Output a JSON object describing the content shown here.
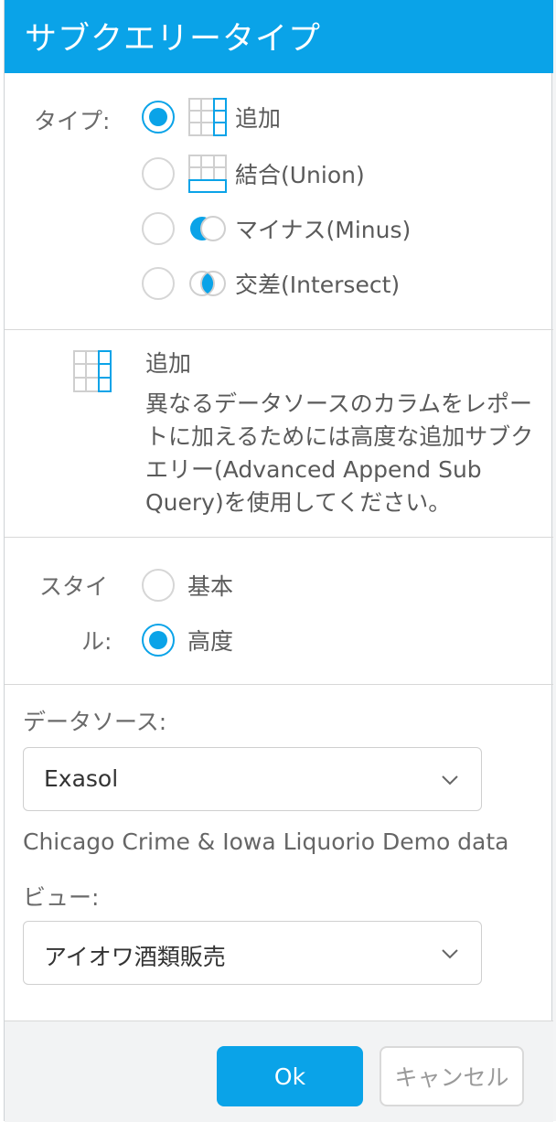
{
  "dialog": {
    "title": "サブクエリータイプ"
  },
  "type_section": {
    "label": "タイプ:",
    "options": [
      {
        "label": "追加",
        "icon": "append-icon",
        "selected": true
      },
      {
        "label": "結合(Union)",
        "icon": "union-icon",
        "selected": false
      },
      {
        "label": "マイナス(Minus)",
        "icon": "minus-icon",
        "selected": false
      },
      {
        "label": "交差(Intersect)",
        "icon": "intersect-icon",
        "selected": false
      }
    ]
  },
  "description": {
    "icon": "append-icon",
    "title": "追加",
    "text": "異なるデータソースのカラムをレポートに加えるためには高度な追加サブクエリー(Advanced Append Sub Query)を使用してください。"
  },
  "style_section": {
    "label_line1": "スタイ",
    "label_line2": "ル:",
    "options": [
      {
        "label": "基本",
        "selected": false
      },
      {
        "label": "高度",
        "selected": true
      }
    ]
  },
  "datasource": {
    "label": "データソース:",
    "value": "Exasol",
    "description": "Chicago Crime & Iowa Liquorio Demo data"
  },
  "view": {
    "label": "ビュー:",
    "value": "アイオワ酒類販売"
  },
  "footer": {
    "ok_label": "Ok",
    "cancel_label": "キャンセル"
  },
  "colors": {
    "accent": "#0aa3e8",
    "footer_bg": "#f2f3f4"
  }
}
